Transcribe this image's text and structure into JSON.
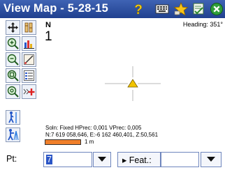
{
  "title_bar": {
    "title": "View Map - 5-28-15",
    "buttons": [
      "help",
      "keyboard",
      "favorites",
      "edit",
      "close"
    ]
  },
  "map": {
    "north_label": "N",
    "north_value": "1",
    "heading": "Heading: 351°",
    "solution_line": "Soln: Fixed HPrec: 0,001 VPrec: 0,005",
    "coords_line": "N:7 619 058,646, E:-6 162 460,401, Z:50,561",
    "scale_label": "1 m"
  },
  "bottom": {
    "pt_label": "Pt:",
    "pt_value": "7",
    "feat_label": "▸ Feat.:",
    "feat_value": ""
  },
  "colors": {
    "titlebar": "#2a4a9e",
    "scalebar": "#f07f2a",
    "position_marker": "#f2c400",
    "crosshair": "#b8b8b8"
  }
}
